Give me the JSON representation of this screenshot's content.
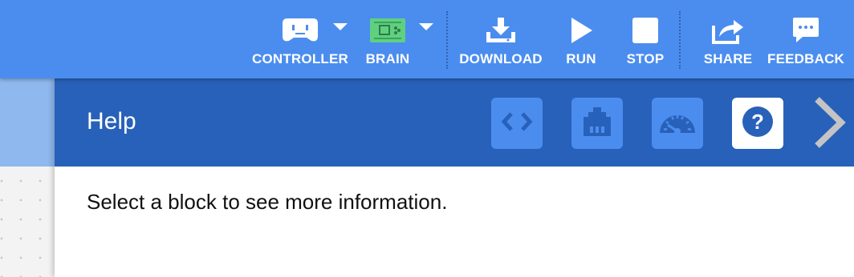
{
  "toolbar": {
    "controller_label": "CONTROLLER",
    "brain_label": "BRAIN",
    "download_label": "DOWNLOAD",
    "run_label": "RUN",
    "stop_label": "STOP",
    "share_label": "SHARE",
    "feedback_label": "FEEDBACK",
    "icons": [
      "controller-icon",
      "brain-icon",
      "download-icon",
      "play-icon",
      "stop-icon",
      "share-icon",
      "feedback-icon"
    ]
  },
  "help_panel": {
    "title": "Help",
    "tabs": [
      {
        "icon": "code-icon"
      },
      {
        "icon": "devices-port-icon"
      },
      {
        "icon": "dashboard-gauge-icon"
      },
      {
        "icon": "help-question-icon",
        "active": true
      }
    ],
    "message": "Select a block to see more information."
  },
  "colors": {
    "toolbar": "#4b8def",
    "panel_header": "#2861b9",
    "tab_inactive": "#4b8def",
    "brain_green": "#5fd07f"
  }
}
